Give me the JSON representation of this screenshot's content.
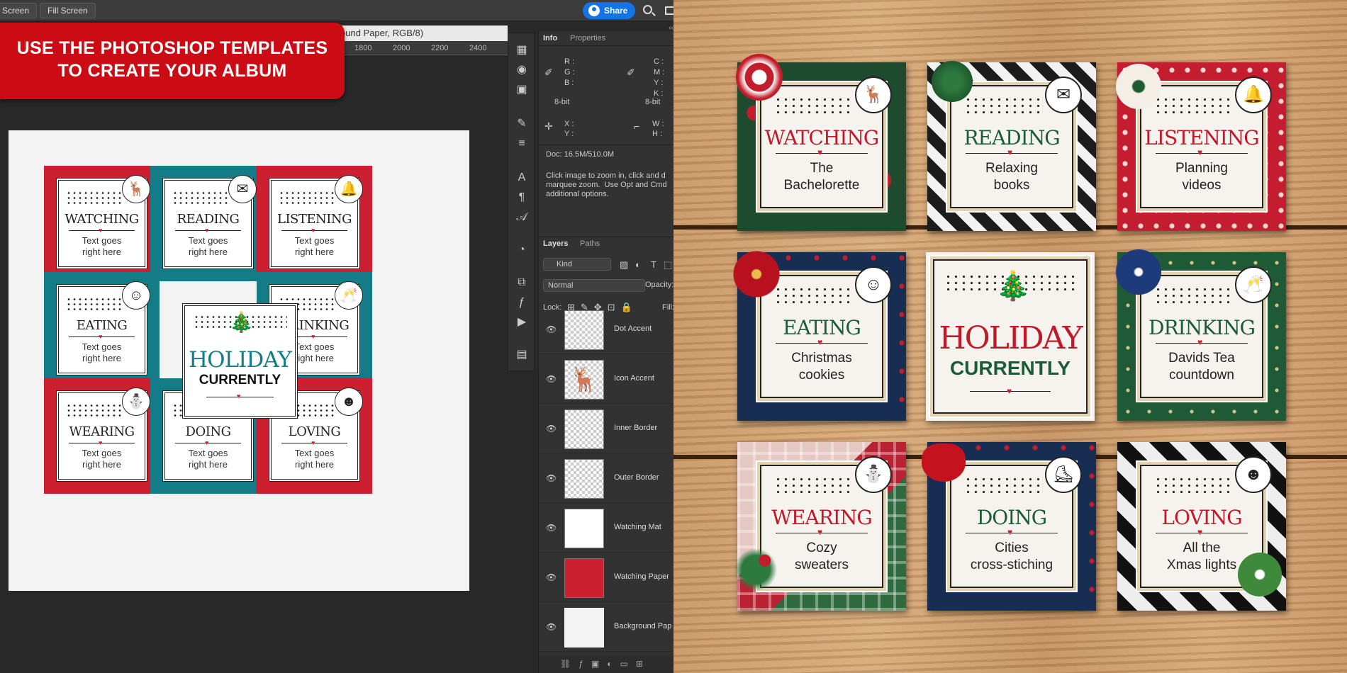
{
  "ps": {
    "buttons": [
      "Screen",
      "Fill Screen"
    ],
    "share_label": "Share",
    "doc_tab": "ound Paper, RGB/8)",
    "ruler_ticks": [
      "1800",
      "2000",
      "2200",
      "2400"
    ],
    "banner_line1": "USE THE PHOTOSHOP TEMPLATES",
    "banner_line2": "TO CREATE YOUR ALBUM",
    "info_tab": "Info",
    "properties_tab": "Properties",
    "info_rgb": "R :\nG :\nB :",
    "info_cmyk": "C :\nM :\nY :\nK :",
    "bit_left": "8-bit",
    "bit_right": "8-bit",
    "info_xy": "X :\nY :",
    "info_wh": "W :\nH :",
    "doc_size": "Doc: 16.5M/510.0M",
    "hint": "Click image to zoom in, click and d\nmarquee zoom.  Use Opt and Cmd\nadditional options.",
    "layers_tab": "Layers",
    "paths_tab": "Paths",
    "kind_label": "Kind",
    "blend_mode": "Normal",
    "opacity_label": "Opacity:",
    "lock_label": "Lock:",
    "fill_label": "Fill:",
    "layers": [
      "Dot Accent",
      "Icon Accent",
      "Inner Border",
      "Outer Border",
      "Watching Mat",
      "Watching Paper",
      "Background Pap"
    ]
  },
  "template_cards": [
    {
      "word": "WATCHING",
      "text": "Text goes\nright here",
      "icon": "reindeer-icon",
      "glyph": "🦌",
      "bg": "red"
    },
    {
      "word": "READING",
      "text": "Text goes\nright here",
      "icon": "envelope-icon",
      "glyph": "✉",
      "bg": "teal"
    },
    {
      "word": "LISTENING",
      "text": "Text goes\nright here",
      "icon": "bell-icon",
      "glyph": "🔔",
      "bg": "red"
    },
    {
      "word": "EATING",
      "text": "Text goes\nright here",
      "icon": "gingerbread-icon",
      "glyph": "☺",
      "bg": "teal"
    },
    {
      "word": "DRINKING",
      "text": "Text goes\nright here",
      "icon": "champagne-icon",
      "glyph": "🥂",
      "bg": "teal"
    },
    {
      "word": "WEARING",
      "text": "Text goes\nright here",
      "icon": "santa-hat-icon",
      "glyph": "⛄",
      "bg": "red"
    },
    {
      "word": "DOING",
      "text": "Text goes\nright here",
      "icon": "ice-skate-icon",
      "glyph": "⛸",
      "bg": "teal"
    },
    {
      "word": "LOVING",
      "text": "Text goes\nright here",
      "icon": "santa-face-icon",
      "glyph": "☻",
      "bg": "red"
    }
  ],
  "center_title_1": "HOLIDAY",
  "center_title_2": "CURRENTLY",
  "photo_cards": [
    {
      "word": "WATCHING",
      "text": "The\nBachelorette",
      "color": "red",
      "pattern": "floral-green",
      "glyph": "🦌"
    },
    {
      "word": "READING",
      "text": "Relaxing\nbooks",
      "color": "green",
      "pattern": "stripe",
      "glyph": "✉"
    },
    {
      "word": "LISTENING",
      "text": "Planning\nvideos",
      "color": "red",
      "pattern": "quatrefoil",
      "glyph": "🔔"
    },
    {
      "word": "EATING",
      "text": "Christmas\ncookies",
      "color": "green",
      "pattern": "navy",
      "glyph": "☺"
    },
    {
      "word": "DRINKING",
      "text": "Davids Tea\ncountdown",
      "color": "green",
      "pattern": "star",
      "glyph": "🥂"
    },
    {
      "word": "WEARING",
      "text": "Cozy\nsweaters",
      "color": "red",
      "pattern": "plaid",
      "glyph": "⛄"
    },
    {
      "word": "DOING",
      "text": "Cities\ncross-stiching",
      "color": "green",
      "pattern": "navy",
      "glyph": "⛸"
    },
    {
      "word": "LOVING",
      "text": "All the\nXmas lights",
      "color": "red",
      "pattern": "buffalo",
      "glyph": "☻"
    }
  ],
  "colors": {
    "red": "#cc1f2f",
    "teal": "#137c86",
    "green": "#1b5c38",
    "share": "#1473e6"
  }
}
